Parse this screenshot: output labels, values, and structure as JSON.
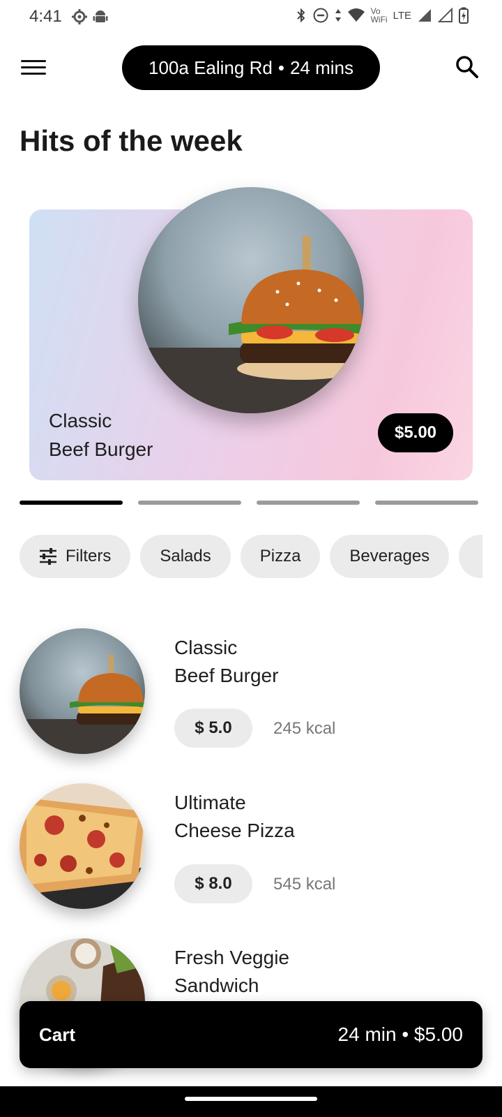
{
  "status_bar": {
    "time": "4:41",
    "left_icons": [
      "settings-icon",
      "android-icon"
    ],
    "right_icons": [
      "bluetooth-icon",
      "do-not-disturb-icon",
      "data-arrows-icon",
      "wifi-icon",
      "vowifi-icon",
      "lte-icon",
      "signal-icon",
      "signal-empty-icon",
      "battery-charging-icon"
    ],
    "vowifi_text": "Vo WiFi",
    "lte_text": "LTE"
  },
  "app_bar": {
    "menu_icon": "menu-icon",
    "address": "100a Ealing Rd",
    "separator": "•",
    "eta": "24 mins",
    "search_icon": "search-icon"
  },
  "section_title": "Hits of the week",
  "featured": {
    "name_line1": "Classic",
    "name_line2": "Beef Burger",
    "price": "$5.00",
    "image_icon": "burger-photo"
  },
  "pager": {
    "count": 4,
    "active_index": 0
  },
  "chips": [
    {
      "label": "Filters",
      "icon": "tune-icon"
    },
    {
      "label": "Salads"
    },
    {
      "label": "Pizza"
    },
    {
      "label": "Beverages"
    },
    {
      "label": ""
    }
  ],
  "menu_items": [
    {
      "name_line1": "Classic",
      "name_line2": "Beef Burger",
      "price": "$ 5.0",
      "kcal": "245 kcal",
      "image": "burger-photo"
    },
    {
      "name_line1": "Ultimate",
      "name_line2": "Cheese Pizza",
      "price": "$ 8.0",
      "kcal": "545 kcal",
      "image": "pizza-photo"
    },
    {
      "name_line1": "Fresh Veggie",
      "name_line2": "Sandwich",
      "price": "",
      "kcal": "",
      "image": "sandwich-photo"
    }
  ],
  "cart": {
    "label": "Cart",
    "summary": "24 min • $5.00"
  },
  "colors": {
    "primary": "#000000",
    "chip_bg": "#ebebeb",
    "card_gradient_start": "#cfe0f4",
    "card_gradient_end": "#fad6e4"
  }
}
